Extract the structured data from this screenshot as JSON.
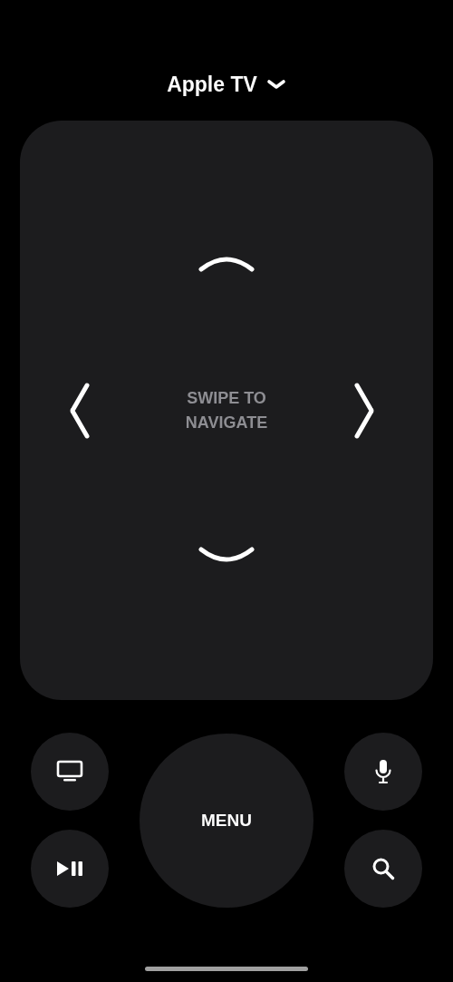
{
  "device": {
    "name": "Apple TV"
  },
  "touchpad": {
    "hint": "SWIPE TO NAVIGATE"
  },
  "buttons": [
    {
      "kind": "tv"
    },
    {
      "kind": "menu",
      "label": "MENU"
    },
    {
      "kind": "mic"
    },
    {
      "kind": "playpause"
    },
    {
      "kind": "search"
    }
  ]
}
